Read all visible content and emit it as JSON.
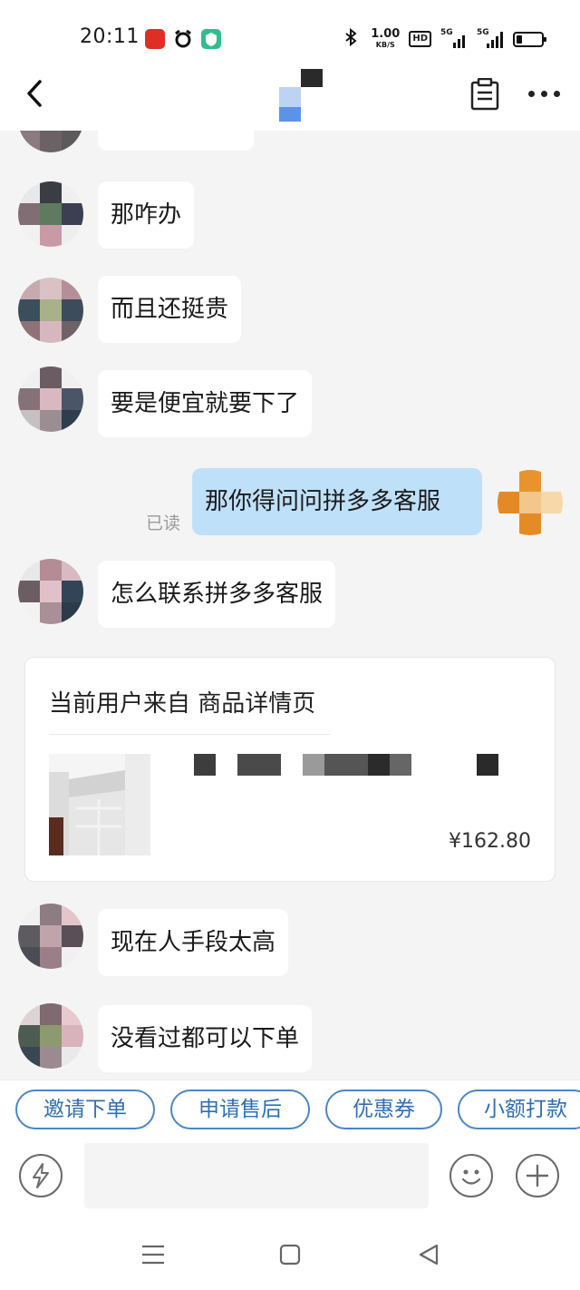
{
  "status_bar": {
    "time": "20:11",
    "net_speed_value": "1.00",
    "net_speed_unit": "KB/S",
    "hd_label": "HD",
    "sim1_label": "5G",
    "sim2_label": "5G",
    "icons": [
      "pinduoduo-app-icon",
      "alarm-icon",
      "security-app-icon",
      "bluetooth-icon",
      "hd-icon",
      "signal-icon",
      "battery-icon"
    ]
  },
  "header": {
    "icons": [
      "back-icon",
      "contact-avatar",
      "notebook-icon",
      "more-icon"
    ]
  },
  "messages": [
    {
      "from": "them",
      "text": "那咋办"
    },
    {
      "from": "them",
      "text": "而且还挺贵"
    },
    {
      "from": "them",
      "text": "要是便宜就要下了"
    },
    {
      "from": "me",
      "text": "那你得问问拼多多客服",
      "read_label": "已读"
    },
    {
      "from": "them",
      "text": "怎么联系拼多多客服"
    },
    {
      "from": "them",
      "text": "现在人手段太高"
    },
    {
      "from": "them",
      "text": "没看过都可以下单"
    }
  ],
  "product_card": {
    "title": "当前用户来自 商品详情页",
    "price": "¥162.80"
  },
  "quick_actions": [
    {
      "label": "邀请下单"
    },
    {
      "label": "申请售后"
    },
    {
      "label": "优惠券"
    },
    {
      "label": "小额打款"
    }
  ],
  "input_bar": {
    "placeholder": "",
    "icons": [
      "lightning-icon",
      "emoji-icon",
      "plus-icon"
    ]
  },
  "nav_bar": {
    "icons": [
      "menu-icon",
      "home-square-icon",
      "back-triangle-icon"
    ]
  },
  "colors": {
    "mine_bubble": "#bfe0f9",
    "their_bubble": "#ffffff",
    "chip_border": "#4a86c8",
    "chip_text": "#2f6fb6",
    "chat_background": "#f4f4f4"
  }
}
